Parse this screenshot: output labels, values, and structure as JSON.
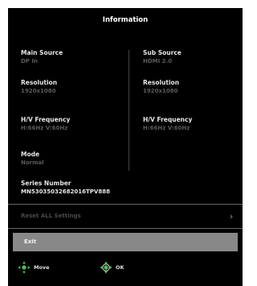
{
  "osd": {
    "title": "Information",
    "left": [
      {
        "label": "Main Source",
        "value": "DP In"
      },
      {
        "label": "Resolution",
        "value": "1920x1080"
      },
      {
        "label": "H/V Frequency",
        "value": "H:66Hz  V:60Hz"
      },
      {
        "label": "Mode",
        "value": "Normal"
      },
      {
        "label": "Series Number",
        "value": "MN53035032682016TPV888"
      }
    ],
    "right": [
      {
        "label": "Sub Source",
        "value": "HDMI 2.0"
      },
      {
        "label": "Resolution",
        "value": "1920x1080"
      },
      {
        "label": "H/V Frequency",
        "value": "H:66Hz  V:60Hz"
      }
    ],
    "reset_label": "Reset  ALL  Settings",
    "exit_label": "Exit",
    "hints": [
      {
        "icon": "joystick-move-icon",
        "label": "Move"
      },
      {
        "icon": "joystick-ok-icon",
        "label": "OK"
      }
    ],
    "colors": {
      "background": "#000000",
      "text": "#e6e6e6",
      "dim_text": "#5a5a5a",
      "selected_bg": "#888888",
      "joystick_green": "#4cc24c"
    }
  }
}
